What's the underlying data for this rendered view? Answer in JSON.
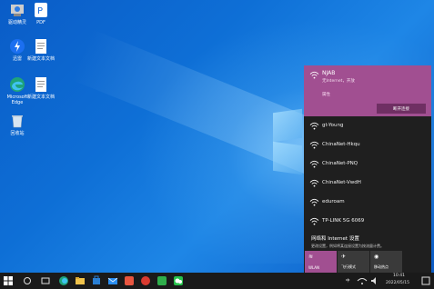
{
  "desktop": {
    "icons": [
      {
        "label": "驱动精灵"
      },
      {
        "label": "PDF"
      },
      {
        "label": "迅雷"
      },
      {
        "label": "新建文本文档"
      },
      {
        "label": "Microsoft Edge"
      },
      {
        "label": "新建文本文档"
      },
      {
        "label": "回收站"
      }
    ]
  },
  "wifi_flyout": {
    "active": {
      "name": "NJAB",
      "status": "无Internet，开放",
      "properties": "属性",
      "disconnect": "断开连接"
    },
    "networks": [
      "gt-Young",
      "ChinaNet-Hkqu",
      "ChinaNet-PNQ",
      "ChinaNet-VwdH",
      "eduroam",
      "TP-LINK 5G 6069"
    ],
    "settings": {
      "title": "网络和 Internet 设置",
      "desc": "更改设置，例如将某连接设置为按流量计费。"
    },
    "tiles": [
      {
        "label": "WLAN",
        "icon": "wifi-icon"
      },
      {
        "label": "飞行模式",
        "icon": "airplane-icon"
      },
      {
        "label": "移动热点",
        "icon": "hotspot-icon"
      }
    ]
  },
  "taskbar": {
    "time": "10:41",
    "date": "2022/05/15",
    "ime": "中"
  },
  "colors": {
    "accent": "#a14f91",
    "flyout_bg": "#1f1f1f",
    "taskbar_bg": "#1a1a1a"
  }
}
